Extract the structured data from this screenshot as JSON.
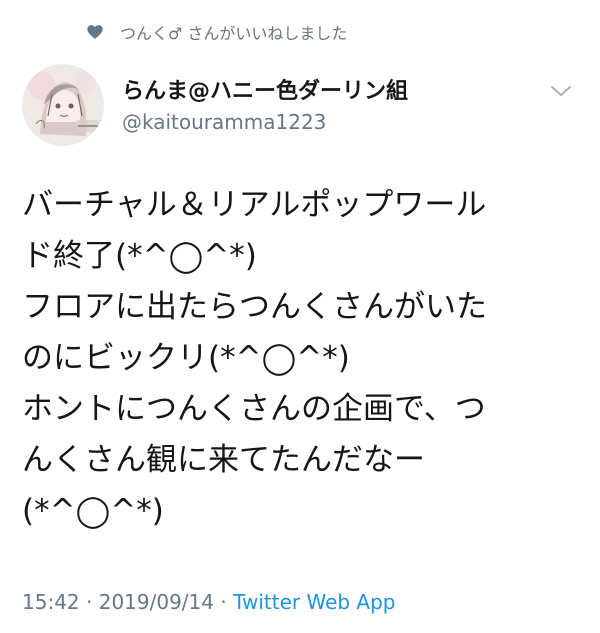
{
  "social_context": {
    "icon": "heart-icon",
    "text": "つんく♂ さんがいいねしました"
  },
  "author": {
    "display_name": "らんま@ハニー色ダーリン組",
    "handle": "@kaitouramma1223"
  },
  "tweet": {
    "lines": [
      "バーチャル＆リアルポップワール",
      "ド終了(*^◯^*)",
      "フロアに出たらつんくさんがいた",
      "のにビックリ(*^◯^*)",
      "ホントにつんくさんの企画で、つ",
      "んくさん観に来てたんだなー",
      "(*^◯^*)"
    ]
  },
  "meta": {
    "time": "15:42",
    "separator1": " · ",
    "date": "2019/09/14",
    "separator2": " · ",
    "source": "Twitter Web App"
  },
  "colors": {
    "secondary_text": "#657786",
    "link": "#1b95e0",
    "primary_text": "#14171a"
  }
}
